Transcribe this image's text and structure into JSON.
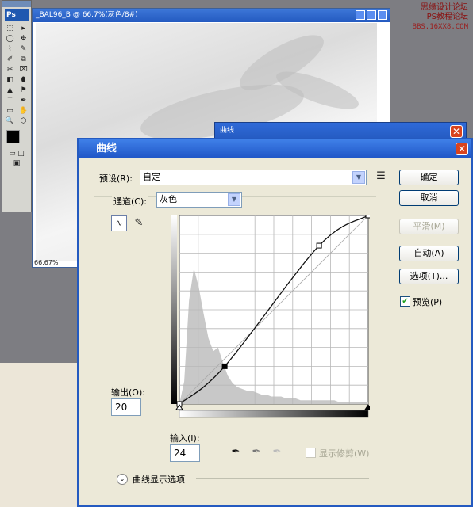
{
  "watermark": {
    "line1": "思缘设计论坛",
    "line2": "PS教程论坛",
    "line3": "BBS.16XX8.COM"
  },
  "toolbox": {
    "logo": "Ps",
    "tools": [
      "⬚",
      "▸",
      "◯",
      "✥",
      "⌇",
      "✎",
      "✐",
      "⧉",
      "✂",
      "⌧",
      "◧",
      "⬮",
      "▲",
      "⚑",
      "T",
      "✒",
      "▭",
      "✋",
      "🔍",
      "⬡"
    ]
  },
  "document": {
    "title": "_BAL96_B @ 66.7%(灰色/8#)",
    "zoom": "66.67%"
  },
  "small_dialog": {
    "title": "曲线"
  },
  "curves": {
    "title": "曲线",
    "preset_label": "预设(R):",
    "preset_value": "自定",
    "channel_label": "通道(C):",
    "channel_value": "灰色",
    "output_label": "输出(O):",
    "output_value": "20",
    "input_label": "输入(I):",
    "input_value": "24",
    "show_clipping_label": "显示修剪(W)",
    "curve_options_label": "曲线显示选项",
    "buttons": {
      "ok": "确定",
      "cancel": "取消",
      "smooth": "平滑(M)",
      "auto": "自动(A)",
      "options": "选项(T)..."
    },
    "preview_label": "预览(P)",
    "preview_checked": true,
    "show_clipping_checked": false,
    "curve_points": [
      {
        "input": 0,
        "output": 0
      },
      {
        "input": 24,
        "output": 20
      },
      {
        "input": 74,
        "output": 84
      },
      {
        "input": 100,
        "output": 100
      }
    ],
    "colors": {
      "titlebar": "#245ac0",
      "dialog_bg": "#ece9d8",
      "histogram": "#c8c8c8"
    }
  }
}
